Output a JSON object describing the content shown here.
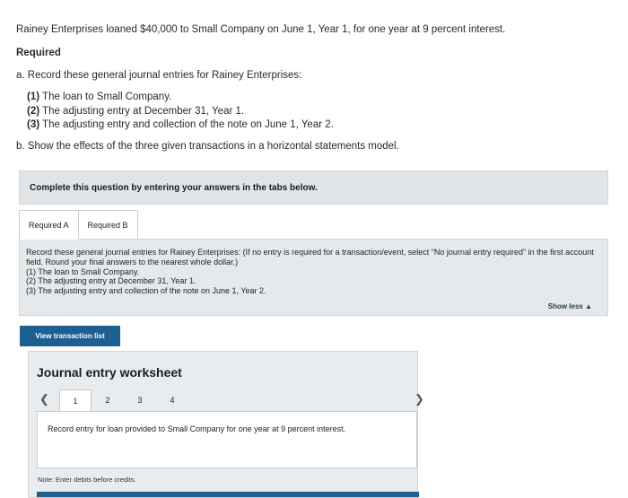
{
  "problem": {
    "intro": "Rainey Enterprises loaned $40,000 to Small Company on June 1, Year 1, for one year at 9 percent interest.",
    "required_heading": "Required",
    "part_a": "a. Record these general journal entries for Rainey Enterprises:",
    "items": [
      {
        "num": "(1)",
        "text": " The loan to Small Company."
      },
      {
        "num": "(2)",
        "text": " The adjusting entry at December 31, Year 1."
      },
      {
        "num": "(3)",
        "text": " The adjusting entry and collection of the note on June 1, Year 2."
      }
    ],
    "part_b": "b. Show the effects of the three given transactions in a horizontal statements model."
  },
  "banner": "Complete this question by entering your answers in the tabs below.",
  "tabs": [
    {
      "label": "Required A",
      "active": true
    },
    {
      "label": "Required B",
      "active": false
    }
  ],
  "panel": {
    "instruction": "Record these general journal entries for Rainey Enterprises: (If no entry is required for a transaction/event, select \"No journal entry required\" in the first account field. Round your final answers to the nearest whole dollar.)",
    "items": [
      "(1) The loan to Small Company.",
      "(2) The adjusting entry at December 31, Year 1.",
      "(3) The adjusting entry and collection of the note on June 1, Year 2."
    ]
  },
  "show_less": "Show less ▲",
  "view_transaction_list": "View transaction list",
  "worksheet": {
    "title": "Journal entry worksheet",
    "pages": [
      "1",
      "2",
      "3",
      "4"
    ],
    "active_page": "1",
    "entry_text": "Record entry for loan provided to Small Company for one year at 9 percent interest.",
    "note": "Note: Enter debits before credits."
  },
  "colors": {
    "button": "#1e5f91",
    "panel_bg": "#e6e9eb",
    "banner_bg": "#e2e5e7"
  }
}
